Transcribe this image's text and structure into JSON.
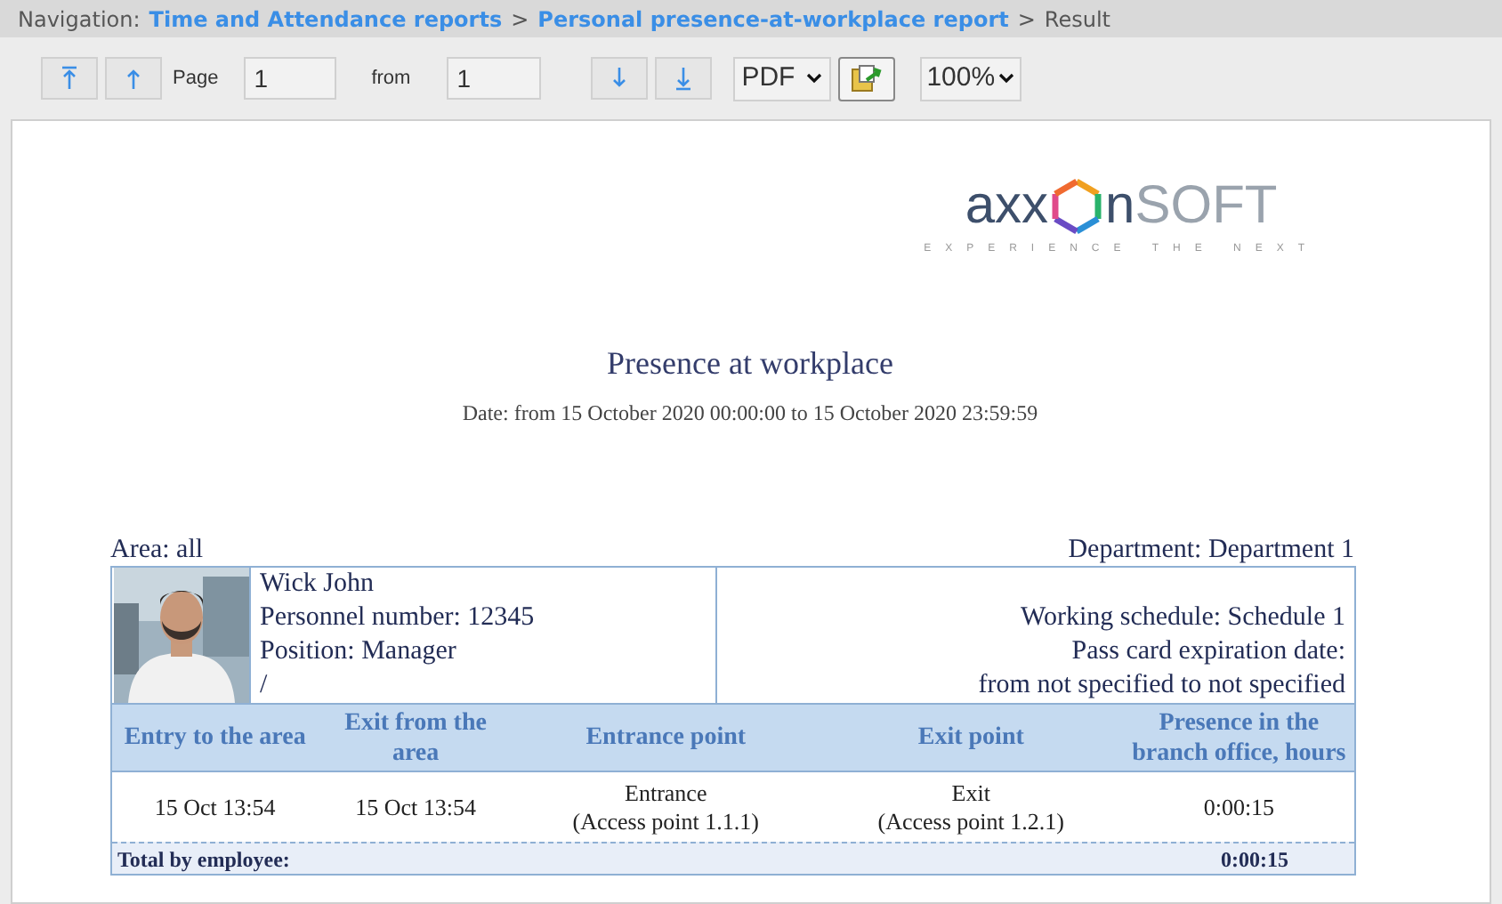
{
  "navigation": {
    "label": "Navigation:",
    "links": [
      "Time and Attendance reports",
      "Personal presence-at-workplace report"
    ],
    "separators": [
      ">",
      ">"
    ],
    "current": "Result"
  },
  "toolbar": {
    "page_label": "Page",
    "page_value": "1",
    "from_label": "from",
    "from_value": "1",
    "format": "PDF",
    "zoom": "100%"
  },
  "logo": {
    "left": "axx",
    "right": "n",
    "suffix": "SOFT",
    "tagline": "EXPERIENCE THE NEXT"
  },
  "report": {
    "title": "Presence at workplace",
    "date": "Date: from 15 October 2020 00:00:00 to 15 October 2020 23:59:59",
    "area": "Area: all",
    "department": "Department: Department 1",
    "employee": {
      "photo": {
        "kind": "picture"
      },
      "lines": [
        "Wick John",
        "Personnel number: 12345",
        "Position: Manager",
        "/"
      ],
      "details": [
        "Working schedule: Schedule 1",
        "Pass card expiration date:",
        "from not specified to not specified"
      ]
    },
    "table": {
      "columns": [
        "Entry to the area",
        "Exit from the area",
        "Entrance point",
        "Exit point",
        "Presence in the branch office, hours"
      ],
      "rows": [
        {
          "cells": [
            [
              "15 Oct 13:54"
            ],
            [
              "15 Oct 13:54"
            ],
            [
              "Entrance",
              "(Access point 1.1.1)"
            ],
            [
              "Exit",
              "(Access point 1.2.1)"
            ],
            [
              "0:00:15"
            ]
          ]
        }
      ],
      "total": {
        "label": "Total by employee:",
        "value": "0:00:15"
      }
    }
  }
}
